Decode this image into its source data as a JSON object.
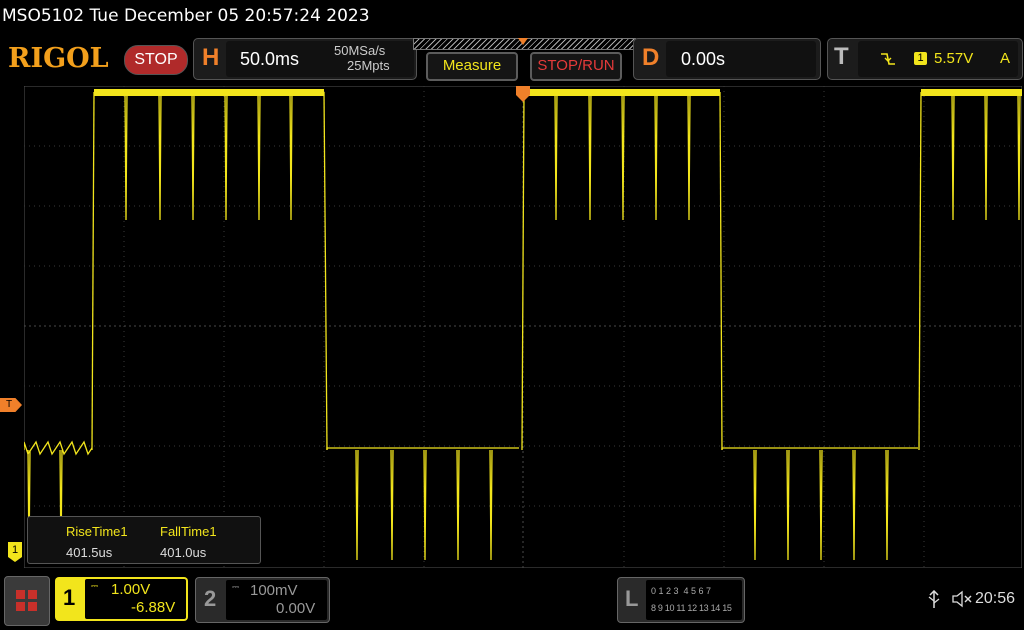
{
  "title_bar": {
    "text": "MSO5102  Tue December 05 20:57:24 2023"
  },
  "brand": {
    "logo": "RIGOL",
    "run_state": "STOP"
  },
  "horizontal": {
    "letter": "H",
    "timebase": "50.0ms",
    "sample_rate": "50MSa/s",
    "memory_depth": "25Mpts"
  },
  "buttons": {
    "measure": "Measure",
    "stop_run": "STOP/RUN"
  },
  "delay": {
    "letter": "D",
    "value": "0.00s"
  },
  "trigger": {
    "letter": "T",
    "edge_icon": "falling-edge-icon",
    "source": "1",
    "level": "5.57V",
    "mode": "A"
  },
  "measurements": [
    {
      "label": "RiseTime1",
      "value": "401.5us"
    },
    {
      "label": "FallTime1",
      "value": "401.0us"
    }
  ],
  "channels": [
    {
      "number": "1",
      "scale": "1.00V",
      "offset": "-6.88V",
      "color": "#f2e51c"
    },
    {
      "number": "2",
      "scale": "100mV",
      "offset": "0.00V",
      "color": "#8a8a8a"
    }
  ],
  "logic": {
    "letter": "L",
    "row1": "0 1 2 3  4 5 6 7",
    "row2": "8 9 10 11 12 13 14 15"
  },
  "status": {
    "time": "20:56",
    "usb_icon": "usb-icon",
    "speaker_icon": "mute-speaker-icon"
  },
  "markers": {
    "trigger_level": "T",
    "channel1_ground": "1"
  },
  "colors": {
    "accent": "#f0802a",
    "trace": "#f2e51c",
    "stop": "#b02a2a",
    "logo": "#f3a01c"
  }
}
